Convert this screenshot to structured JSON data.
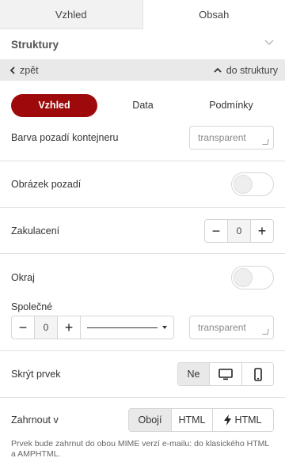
{
  "tabs": {
    "vzhled": "Vzhled",
    "obsah": "Obsah"
  },
  "section": {
    "title": "Struktury"
  },
  "nav": {
    "back": "zpět",
    "up": "do struktury"
  },
  "segments": {
    "vzhled": "Vzhled",
    "data": "Data",
    "podminky": "Podmínky"
  },
  "background_color": {
    "label": "Barva pozadí kontejneru",
    "value": "transparent"
  },
  "background_image": {
    "label": "Obrázek pozadí",
    "enabled": false
  },
  "rounding": {
    "label": "Zakulacení",
    "value": "0"
  },
  "border": {
    "label": "Okraj",
    "enabled": false,
    "common_label": "Společné",
    "width": "0",
    "color": "transparent"
  },
  "hide_element": {
    "label": "Skrýt prvek",
    "option_none": "Ne",
    "icons": [
      "desktop-icon",
      "mobile-icon"
    ]
  },
  "include_in": {
    "label": "Zahrnout v",
    "options": [
      "Obojí",
      "HTML",
      "HTML"
    ],
    "hint": "Prvek bude zahrnut do obou MIME verzí e-mailu: do klasického HTML a AMPHTML."
  },
  "colors": {
    "accent": "#9e0a0b",
    "divider": "#e2e2e2",
    "nav_bg": "#e9e9e9"
  }
}
